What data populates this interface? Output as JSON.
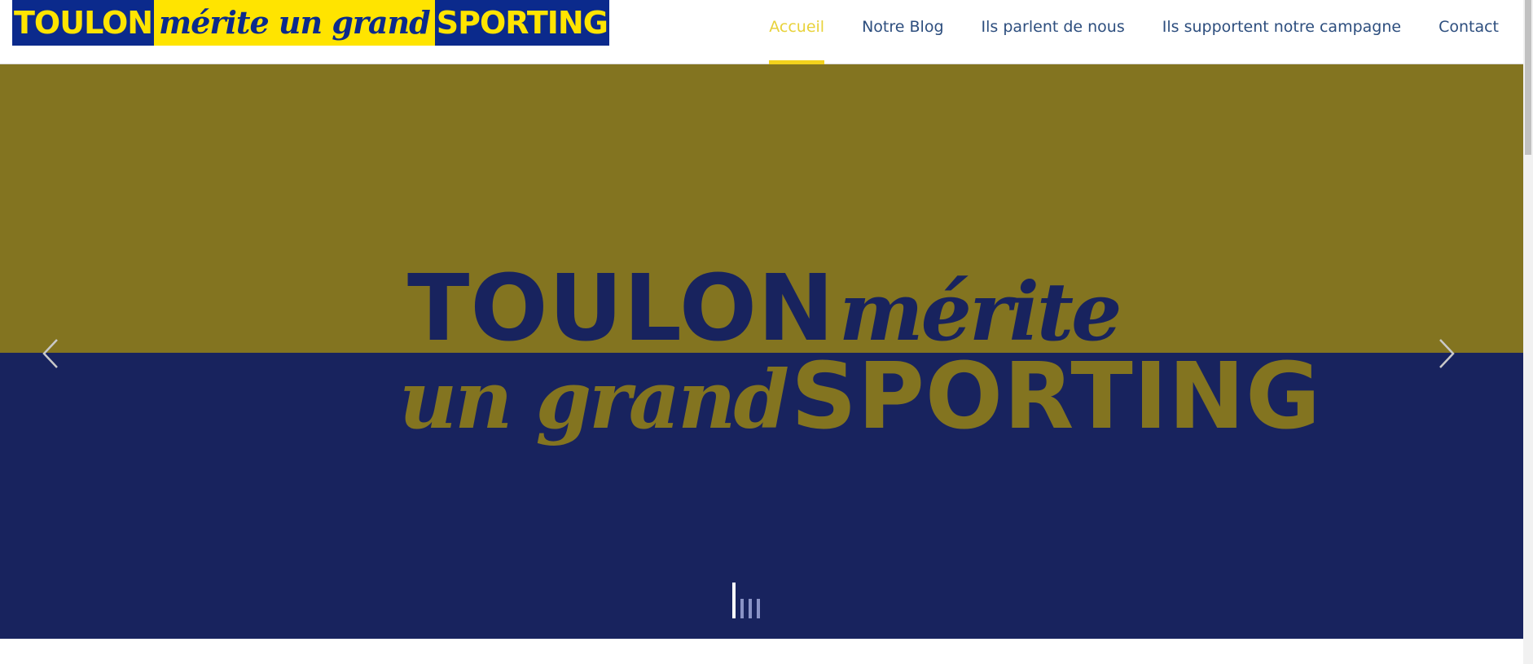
{
  "header": {
    "logo": {
      "part1": "TOULON",
      "part2": "mérite un grand",
      "part3": "SPORTING"
    },
    "nav": [
      {
        "label": "Accueil",
        "active": true
      },
      {
        "label": "Notre Blog",
        "active": false
      },
      {
        "label": "Ils parlent de nous",
        "active": false
      },
      {
        "label": "Ils supportent notre campagne",
        "active": false
      },
      {
        "label": "Contact",
        "active": false
      }
    ]
  },
  "slider": {
    "slide_text": {
      "word1": "TOULON",
      "word2": "mérite",
      "word3": "un grand",
      "word4": "SPORTING"
    },
    "prev_icon": "chevron-left-icon",
    "next_icon": "chevron-right-icon",
    "slide_count": 4,
    "active_slide": 1
  },
  "colors": {
    "nav_text": "#2d4e7e",
    "nav_active": "#e8d23a",
    "gold": "#837420",
    "navy": "#18235e",
    "logo_blue": "#0b2a8c",
    "logo_yellow": "#ffe400"
  }
}
